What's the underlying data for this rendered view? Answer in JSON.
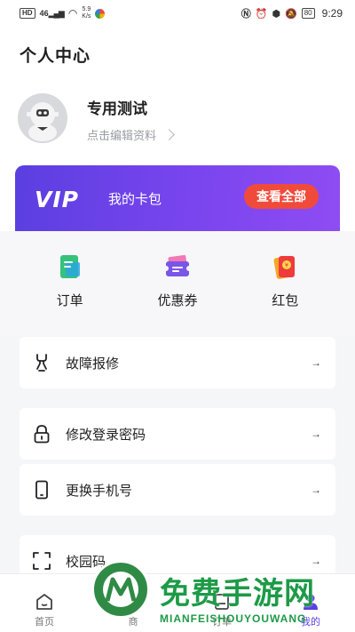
{
  "status_bar": {
    "left_badge": "HD",
    "signal": "46",
    "speed_value": "5.9",
    "speed_unit": "K/s",
    "battery": "80",
    "time": "9:29"
  },
  "header": {
    "title": "个人中心"
  },
  "profile": {
    "name": "专用测试",
    "edit_label": "点击编辑资料"
  },
  "vip": {
    "logo": "VIP",
    "label": "我的卡包",
    "button": "查看全部",
    "colors": {
      "gradient_start": "#5b3fe0",
      "gradient_end": "#8f4cf3",
      "button": "#f04a3b"
    }
  },
  "quick_actions": [
    {
      "label": "订单",
      "icon": "order-icon"
    },
    {
      "label": "优惠券",
      "icon": "coupon-icon"
    },
    {
      "label": "红包",
      "icon": "red-envelope-icon"
    }
  ],
  "menu": [
    {
      "label": "故障报修",
      "icon": "wrench-icon",
      "arrow": "→"
    },
    {
      "label": "修改登录密码",
      "icon": "lock-icon",
      "arrow": "→"
    },
    {
      "label": "更换手机号",
      "icon": "phone-icon",
      "arrow": "→"
    },
    {
      "label": "校园码",
      "icon": "scan-icon",
      "arrow": "→"
    }
  ],
  "tabs": [
    {
      "label": "首页",
      "icon": "home-icon"
    },
    {
      "label": "商",
      "icon": "shop-icon"
    },
    {
      "label": "订单",
      "icon": "order-tab-icon"
    },
    {
      "label": "我的",
      "icon": "user-icon"
    }
  ],
  "watermark": {
    "title": "免费手游网",
    "subtitle": "MIANFEISHOUYOUWANG"
  }
}
